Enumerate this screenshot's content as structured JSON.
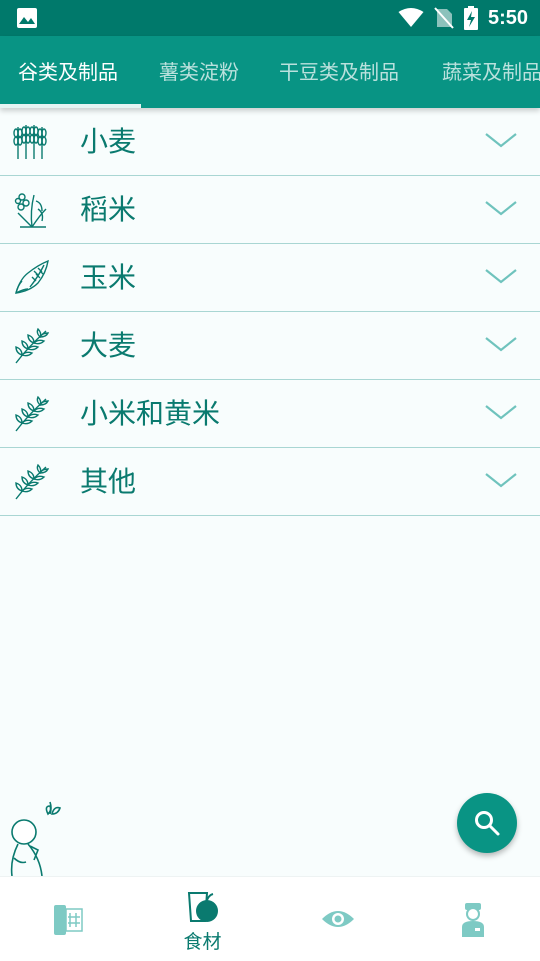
{
  "status_bar": {
    "time": "5:50",
    "icons": [
      "image-icon",
      "wifi-icon",
      "no-sim-icon",
      "battery-charging-icon"
    ]
  },
  "tabs": [
    {
      "label": "谷类及制品",
      "active": true
    },
    {
      "label": "薯类淀粉",
      "active": false
    },
    {
      "label": "干豆类及制品",
      "active": false
    },
    {
      "label": "蔬菜及制品",
      "active": false
    }
  ],
  "categories": [
    {
      "label": "小麦",
      "icon": "wheat-icon"
    },
    {
      "label": "稻米",
      "icon": "rice-plant-icon"
    },
    {
      "label": "玉米",
      "icon": "corn-icon"
    },
    {
      "label": "大麦",
      "icon": "grain-sprig-icon"
    },
    {
      "label": "小米和黄米",
      "icon": "grain-sprig-icon"
    },
    {
      "label": "其他",
      "icon": "grain-sprig-icon"
    }
  ],
  "fab": {
    "icon": "search-icon"
  },
  "bottom_nav": [
    {
      "icon": "recipe-book-icon",
      "label": "",
      "active": false
    },
    {
      "icon": "ingredients-icon",
      "label": "食材",
      "active": true
    },
    {
      "icon": "eye-icon",
      "label": "",
      "active": false
    },
    {
      "icon": "doctor-icon",
      "label": "",
      "active": false
    }
  ],
  "colors": {
    "status_bar": "#00796b",
    "tab_bar": "#089484",
    "accent": "#0a7a6f",
    "divider": "#a9d6d3",
    "background": "#f8fdfd",
    "fab": "#099484"
  }
}
